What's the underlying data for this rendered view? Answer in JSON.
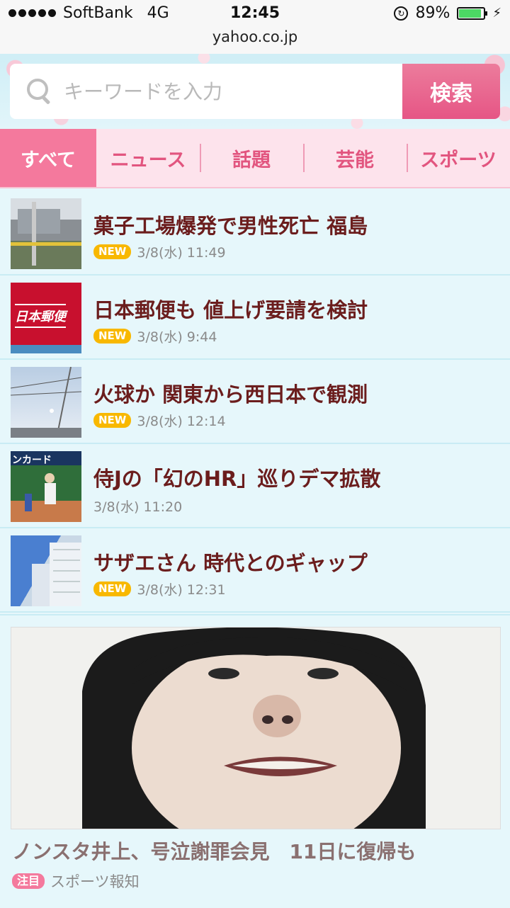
{
  "status_bar": {
    "carrier": "SoftBank",
    "network": "4G",
    "time": "12:45",
    "battery_percent_text": "89%",
    "battery_level": 0.89
  },
  "url_bar": {
    "url": "yahoo.co.jp"
  },
  "search": {
    "placeholder": "キーワードを入力",
    "button_label": "検索"
  },
  "tabs": [
    {
      "label": "すべて",
      "active": true
    },
    {
      "label": "ニュース",
      "active": false
    },
    {
      "label": "話題",
      "active": false
    },
    {
      "label": "芸能",
      "active": false
    },
    {
      "label": "スポーツ",
      "active": false
    }
  ],
  "news": [
    {
      "title": "菓子工場爆発で男性死亡 福島",
      "new": true,
      "new_label": "NEW",
      "date": "3/8(水) 11:49",
      "thumb_text": ""
    },
    {
      "title": "日本郵便も 値上げ要請を検討",
      "new": true,
      "new_label": "NEW",
      "date": "3/8(水) 9:44",
      "thumb_text": "日本郵便"
    },
    {
      "title": "火球か 関東から西日本で観測",
      "new": true,
      "new_label": "NEW",
      "date": "3/8(水) 12:14",
      "thumb_text": ""
    },
    {
      "title": "侍Jの「幻のHR」巡りデマ拡散",
      "new": false,
      "new_label": "",
      "date": "3/8(水) 11:20",
      "thumb_text": "ンカード"
    },
    {
      "title": "サザエさん 時代とのギャップ",
      "new": true,
      "new_label": "NEW",
      "date": "3/8(水) 12:31",
      "thumb_text": ""
    }
  ],
  "feature": {
    "title": "ノンスタ井上、号泣謝罪会見　11日に復帰も",
    "badge": "注目",
    "source": "スポーツ報知"
  },
  "colors": {
    "accent_pink": "#f4799d",
    "search_button": "#e65585",
    "headline": "#6b1d1d",
    "new_badge": "#f8b800",
    "background": "#e6f7fb"
  }
}
